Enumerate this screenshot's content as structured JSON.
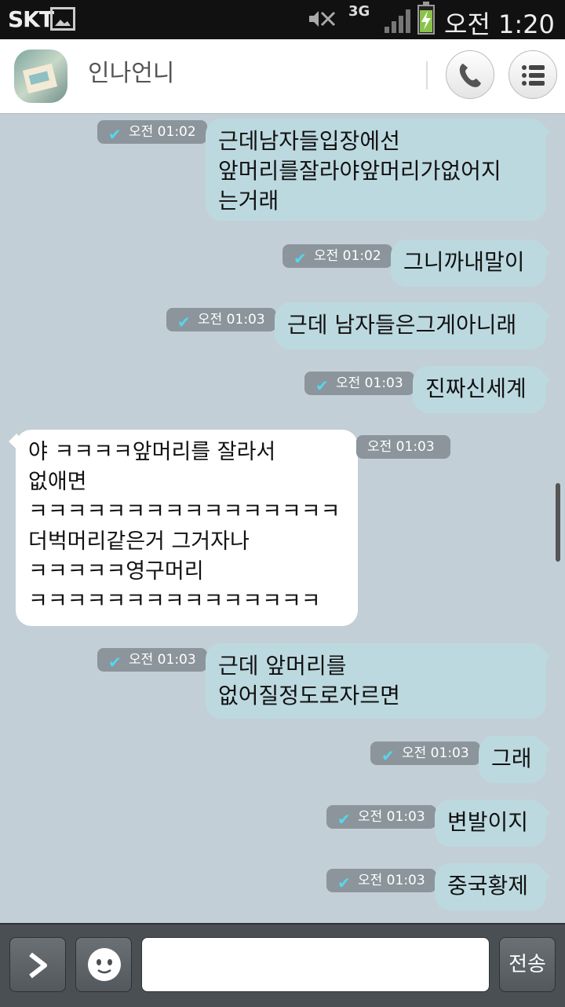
{
  "status_bar": {
    "carrier": "SKT",
    "network": "3G",
    "time": "오전 1:20",
    "icons": [
      "gallery-icon",
      "mute-icon",
      "signal-icon",
      "battery-charging-icon"
    ]
  },
  "header": {
    "title": "인나언니",
    "icons": [
      "call-icon",
      "menu-icon"
    ]
  },
  "colors": {
    "outgoing_bubble": "#bdd9e0",
    "incoming_bubble": "#ffffff",
    "background": "#c3cfd6",
    "timestamp": "#8b959b",
    "check": "#55d6ee"
  },
  "messages": [
    {
      "direction": "out",
      "text": "근데남자들입장에선\n앞머리를잘라야앞머리가없어지\n는거래",
      "time": "오전 01:02",
      "read": true
    },
    {
      "direction": "out",
      "text": "그니까내말이",
      "time": "오전 01:02",
      "read": true
    },
    {
      "direction": "out",
      "text": "근데 남자들은그게아니래",
      "time": "오전 01:03",
      "read": true
    },
    {
      "direction": "out",
      "text": "진짜신세계",
      "time": "오전 01:03",
      "read": true
    },
    {
      "direction": "in",
      "text": "야 ㅋㅋㅋㅋ앞머리를 잘라서\n없애면\nㅋㅋㅋㅋㅋㅋㅋㅋㅋㅋㅋㅋㅋㅋㅋㅋ\n더벅머리같은거 그거자나\nㅋㅋㅋㅋㅋ영구머리\nㅋㅋㅋㅋㅋㅋㅋㅋㅋㅋㅋㅋㅋㅋㅋ",
      "time": "오전 01:03",
      "read": false
    },
    {
      "direction": "out",
      "text": "근데 앞머리를\n없어질정도로자르면",
      "time": "오전 01:03",
      "read": true
    },
    {
      "direction": "out",
      "text": "그래",
      "time": "오전 01:03",
      "read": true
    },
    {
      "direction": "out",
      "text": "변발이지",
      "time": "오전 01:03",
      "read": true
    },
    {
      "direction": "out",
      "text": "중국황제",
      "time": "오전 01:03",
      "read": true
    }
  ],
  "input_bar": {
    "input_value": "",
    "send_label": "전송",
    "icons": [
      "chevron-right-icon",
      "emoticon-icon"
    ]
  }
}
